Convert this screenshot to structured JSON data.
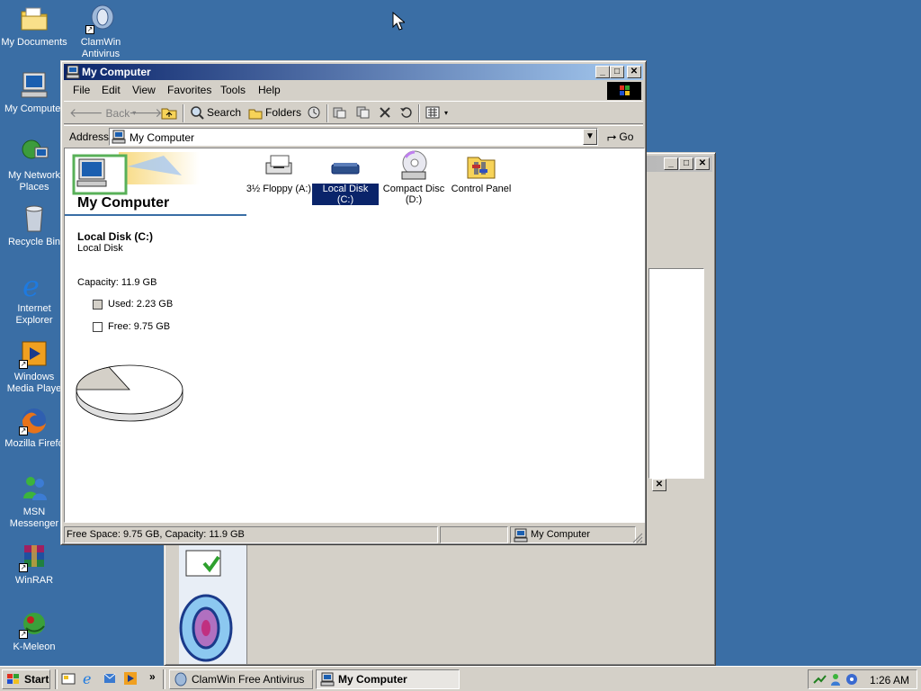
{
  "desktop": {
    "icons": [
      {
        "label": "My Documents",
        "icon": "folder-documents-icon"
      },
      {
        "label": "ClamWin Antivirus",
        "icon": "clamwin-icon"
      },
      {
        "label": "My Computer",
        "icon": "computer-icon"
      },
      {
        "label": "My Network Places",
        "icon": "network-places-icon"
      },
      {
        "label": "Recycle Bin",
        "icon": "recycle-bin-icon"
      },
      {
        "label": "Internet Explorer",
        "icon": "internet-explorer-icon"
      },
      {
        "label": "Windows Media Playe",
        "icon": "media-player-icon"
      },
      {
        "label": "Mozilla Firefo",
        "icon": "firefox-icon"
      },
      {
        "label": "MSN Messenger",
        "icon": "msn-messenger-icon"
      },
      {
        "label": "WinRAR",
        "icon": "winrar-icon"
      },
      {
        "label": "K-Meleon",
        "icon": "k-meleon-icon"
      }
    ]
  },
  "window": {
    "title": "My Computer",
    "menu": [
      "File",
      "Edit",
      "View",
      "Favorites",
      "Tools",
      "Help"
    ],
    "toolbar": {
      "back": "Back",
      "search": "Search",
      "folders": "Folders"
    },
    "address": {
      "label": "Address",
      "value": "My Computer",
      "go": "Go"
    },
    "panel": {
      "heading": "My Computer",
      "selected_name": "Local Disk (C:)",
      "selected_type": "Local Disk",
      "capacity": "Capacity: 11.9 GB",
      "used": "Used: 2.23 GB",
      "free": "Free: 9.75 GB",
      "used_fraction": 0.187
    },
    "items": [
      {
        "label": "3½ Floppy (A:)",
        "icon": "floppy-drive-icon",
        "selected": false
      },
      {
        "label": "Local Disk (C:)",
        "icon": "hard-disk-icon",
        "selected": true
      },
      {
        "label": "Compact Disc (D:)",
        "icon": "cd-drive-icon",
        "selected": false
      },
      {
        "label": "Control Panel",
        "icon": "control-panel-icon",
        "selected": false
      }
    ],
    "status": {
      "left": "Free Space: 9.75 GB, Capacity: 11.9 GB",
      "right": "My Computer"
    }
  },
  "taskbar": {
    "start": "Start",
    "tasks": [
      {
        "label": "ClamWin Free Antivirus",
        "active": false
      },
      {
        "label": "My Computer",
        "active": true
      }
    ],
    "clock": "1:26 AM"
  },
  "colors": {
    "desktop": "#3a6ea5",
    "title_active": "#0a246a",
    "selection": "#0a246a",
    "face": "#d4d0c8"
  }
}
